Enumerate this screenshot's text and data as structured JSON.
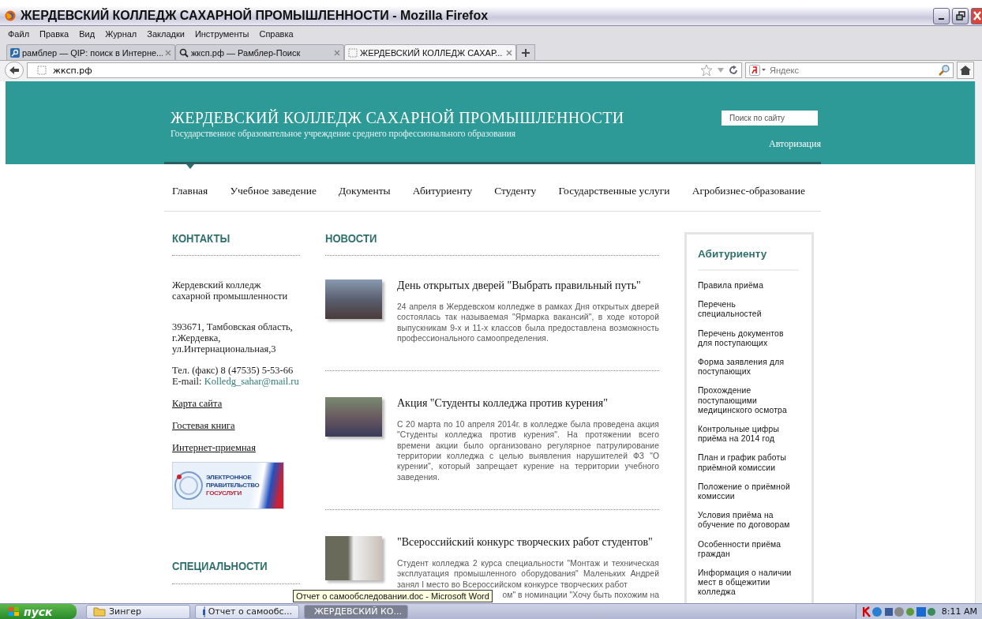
{
  "window": {
    "title": "ЖЕРДЕВСКИЙ КОЛЛЕДЖ САХАРНОЙ ПРОМЫШЛЕННОСТИ - Mozilla Firefox"
  },
  "menu": [
    "Файл",
    "Правка",
    "Вид",
    "Журнал",
    "Закладки",
    "Инструменты",
    "Справка"
  ],
  "tabs": [
    {
      "label": "рамблер — QIP: поиск в Интерне...",
      "kind": "rambler",
      "selected": false
    },
    {
      "label": "жксп.рф — Рамблер-Поиск",
      "kind": "search",
      "selected": false
    },
    {
      "label": "ЖЕРДЕВСКИЙ КОЛЛЕДЖ САХАР...",
      "kind": "page",
      "selected": true
    }
  ],
  "address": {
    "value": "жксп.рф"
  },
  "search": {
    "placeholder": "Яндекс"
  },
  "site": {
    "title": "ЖЕРДЕВСКИЙ КОЛЛЕДЖ САХАРНОЙ ПРОМЫШЛЕННОСТИ",
    "subtitle": "Государственное образовательное учреждение среднего профессионального образования",
    "search_placeholder": "Поиск по сайту",
    "login": "Авторизация"
  },
  "nav": [
    {
      "label": "Главная",
      "selected": true
    },
    {
      "label": "Учебное заведение",
      "selected": false
    },
    {
      "label": "Документы",
      "selected": false
    },
    {
      "label": "Абитуриенту",
      "selected": false
    },
    {
      "label": "Студенту",
      "selected": false
    },
    {
      "label": "Государственные услуги",
      "selected": false
    },
    {
      "label": "Агробизнес-образование",
      "selected": false
    }
  ],
  "contacts": {
    "heading": "КОНТАКТЫ",
    "org": "Жердевский колледж сахарной промышленности",
    "address": "393671, Тамбовская область, г.Жердевка, ул.Интернациональная,3",
    "phone": "Тел. (факс) 8 (47535) 5-53-66",
    "email_label": "E-mail:",
    "email": "Kolledg_sahar@mail.ru",
    "links": [
      "Карта сайта",
      "Гостевая книга",
      "Интернет-приемная"
    ],
    "banner": [
      "ЭЛЕКТРОННОЕ",
      "ПРАВИТЕЛЬСТВО",
      "ГОСУСЛУГИ"
    ]
  },
  "specialties": {
    "heading": "СПЕЦИАЛЬНОСТИ"
  },
  "news": {
    "heading": "НОВОСТИ",
    "items": [
      {
        "title": "День открытых дверей \"Выбрать правильный путь\"",
        "text": "24 апреля в Жердевском колледже в рамках Дня открытых дверей состоялась так называемая \"Ярмарка вакансий\", в ходе которой выпускникам 9-х и 11-х классов была предоставлена возможность профессионального самоопределения."
      },
      {
        "title": "Акция \"Студенты колледжа против курения\"",
        "text": "С 20 марта по 10 апреля 2014г. в колледже была проведена акция \"Студенты колледжа против курения\". На протяжении всего времени акции было организовано регулярное патрулирование территории колледжа с целью выявления нарушителей ФЗ \"О курении\", который запрещает курение на территории учебного заведения."
      },
      {
        "title": "\"Всероссийский конкурс творческих работ студентов\"",
        "text": "Студент колледжа 2 курса специальности \"Монтаж и техническая эксплуатация промышленного оборудования\" Маленьких Андрей занял I место во Всероссийском конкурсе творческих работ",
        "tail": "ом\" в номинации \"Хочу быть похожим на"
      }
    ]
  },
  "sidebar": {
    "heading": "Абитуриенту",
    "items": [
      "Правила приёма",
      "Перечень специальностей",
      "Перечень документов для поступающих",
      "Форма заявления для поступающих",
      "Прохождение поступающими медицинского осмотра",
      "Контрольные цифры приёма на 2014 год",
      "План и график работы приёмной комиссии",
      "Положение о приёмной комиссии",
      "Условия приёма на обучение по договорам",
      "Особенности приёма граждан",
      "Информация о наличии мест в общежитии колледжа"
    ]
  },
  "tooltip": "Отчет о самообследовании.doc - Microsoft Word",
  "taskbar": {
    "start": "пуск",
    "tasks": [
      {
        "label": "Зингер",
        "kind": "folder",
        "selected": false
      },
      {
        "label": "Отчет о самообс...",
        "kind": "word",
        "selected": false
      },
      {
        "label": "ЖЕРДЕВСКИЙ КО...",
        "kind": "firefox",
        "selected": true
      }
    ],
    "clock": "8:11 AM"
  }
}
